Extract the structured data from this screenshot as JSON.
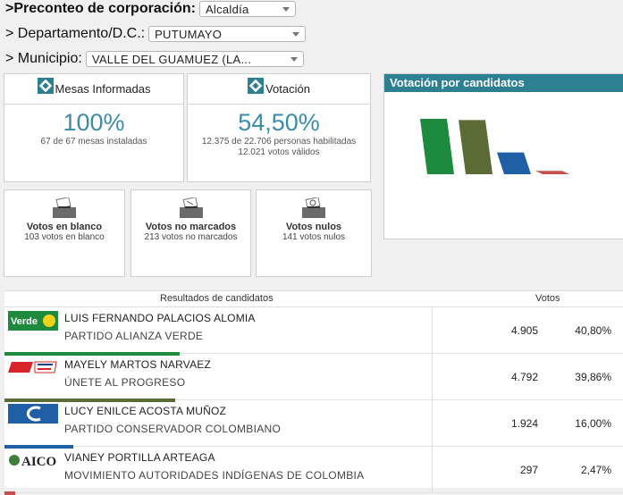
{
  "filters": {
    "corporacion": {
      "label": "Preconteo de corporación:",
      "value": "Alcaldía"
    },
    "departamento": {
      "label": "Departamento/D.C.:",
      "value": "PUTUMAYO"
    },
    "municipio": {
      "label": "Municipio:",
      "value": "VALLE DEL GUAMUEZ (LA..."
    },
    "prefix": ">"
  },
  "summary": {
    "mesas": {
      "title": "Mesas Informadas",
      "value": "100%",
      "detail": "67 de 67 mesas instaladas",
      "fraction": 1.0
    },
    "votacion": {
      "title": "Votación",
      "value": "54,50%",
      "detail1": "12.375 de 22.706 personas habilitadas",
      "detail2": "12.021 votos válidos",
      "fraction": 0.545
    }
  },
  "special_votes": {
    "blanco": {
      "title": "Votos en blanco",
      "detail": "103 votos en blanco"
    },
    "no_marcados": {
      "title": "Votos no marcados",
      "detail": "213 votos no marcados"
    },
    "nulos": {
      "title": "Votos nulos",
      "detail": "141 votos nulos"
    }
  },
  "chart_panel": {
    "title": "Votación por candidatos"
  },
  "chart_data": {
    "type": "bar",
    "title": "Votación por candidatos",
    "categories": [
      "LUIS FERNANDO PALACIOS ALOMIA",
      "MAYELY MARTOS NARVAEZ",
      "LUCY ENILCE ACOSTA MUÑOZ",
      "VIANEY PORTILLA ARTEAGA"
    ],
    "values": [
      40.8,
      39.86,
      16.0,
      2.47
    ],
    "colors": [
      "#1d8a3d",
      "#5b6b35",
      "#1f5fa6",
      "#c8504c"
    ]
  },
  "results": {
    "header_candidates": "Resultados de candidatos",
    "header_votes": "Votos",
    "rows": [
      {
        "candidate": "LUIS FERNANDO PALACIOS ALOMIA",
        "party": "PARTIDO ALIANZA VERDE",
        "votes": "4.905",
        "pct": "40,80%",
        "fraction": 0.408,
        "color": "#1d8a3d",
        "logo": "alianza-verde-logo",
        "logo_text": "Verde"
      },
      {
        "candidate": "MAYELY MARTOS NARVAEZ",
        "party": "ÚNETE AL PROGRESO",
        "votes": "4.792",
        "pct": "39,86%",
        "fraction": 0.3986,
        "color": "#5b6b35",
        "logo": "unete-progreso-logo",
        "logo_text": ""
      },
      {
        "candidate": "LUCY ENILCE ACOSTA MUÑOZ",
        "party": "PARTIDO CONSERVADOR COLOMBIANO",
        "votes": "1.924",
        "pct": "16,00%",
        "fraction": 0.16,
        "color": "#1f5fa6",
        "logo": "conservador-logo",
        "logo_text": ""
      },
      {
        "candidate": "VIANEY PORTILLA ARTEAGA",
        "party": "MOVIMIENTO AUTORIDADES INDÍGENAS DE COLOMBIA",
        "votes": "297",
        "pct": "2,47%",
        "fraction": 0.0247,
        "color": "#c8504c",
        "logo": "aico-logo",
        "logo_text": "AICO"
      }
    ]
  }
}
